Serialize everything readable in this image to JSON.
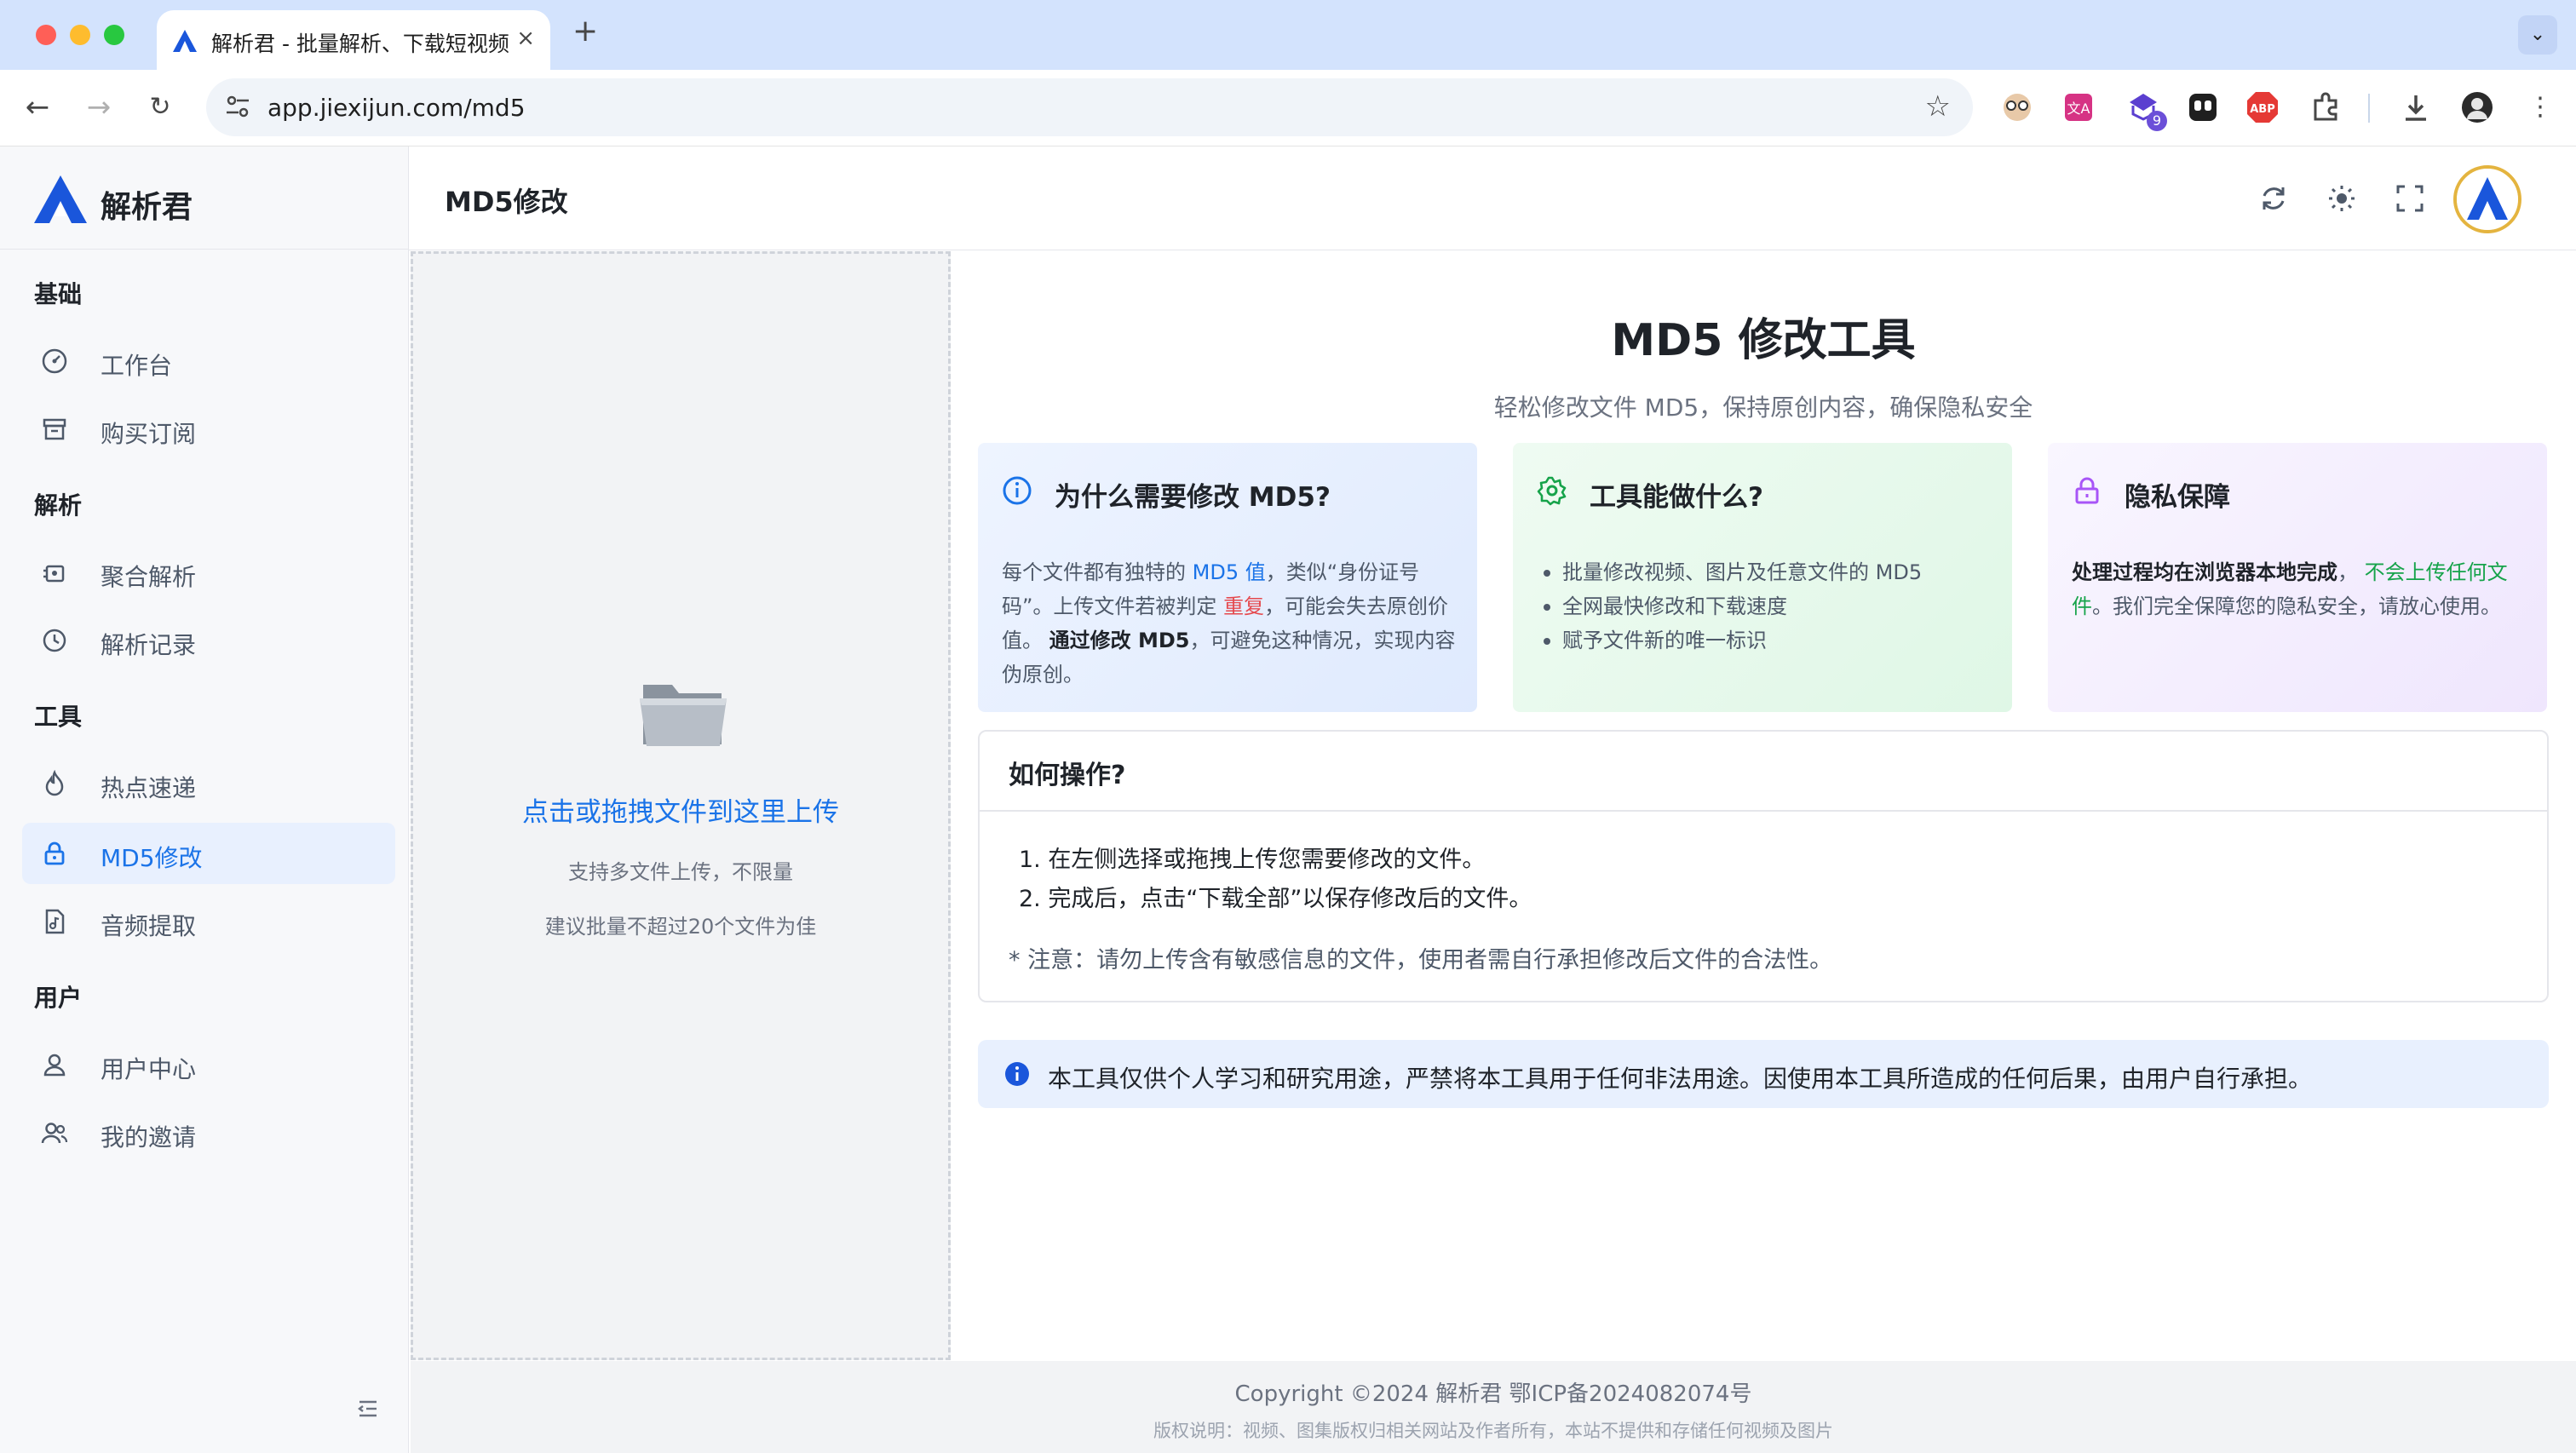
{
  "browser": {
    "tab_title": "解析君 - 批量解析、下载短视频",
    "tab_close": "×",
    "new_tab": "+",
    "url": "app.jiexijun.com/md5",
    "extension_badge": "9",
    "icons": [
      "back-icon",
      "forward-icon",
      "reload-icon",
      "site-info-icon",
      "bookmark-star-icon",
      "downloads-icon",
      "profile-icon",
      "more-icon"
    ]
  },
  "sidebar": {
    "brand_name": "解析君",
    "groups": [
      {
        "title": "基础",
        "items": [
          {
            "label": "工作台",
            "icon": "dashboard-icon"
          },
          {
            "label": "购买订阅",
            "icon": "archive-icon"
          }
        ]
      },
      {
        "title": "解析",
        "items": [
          {
            "label": "聚合解析",
            "icon": "aggregate-icon"
          },
          {
            "label": "解析记录",
            "icon": "history-icon"
          }
        ]
      },
      {
        "title": "工具",
        "items": [
          {
            "label": "热点速递",
            "icon": "fire-icon"
          },
          {
            "label": "MD5修改",
            "icon": "lock-icon",
            "active": true
          },
          {
            "label": "音频提取",
            "icon": "audio-file-icon"
          }
        ]
      },
      {
        "title": "用户",
        "items": [
          {
            "label": "用户中心",
            "icon": "user-icon"
          },
          {
            "label": "我的邀请",
            "icon": "users-icon"
          }
        ]
      }
    ]
  },
  "header": {
    "page_title": "MD5修改",
    "icons": [
      "refresh-icon",
      "theme-sun-icon",
      "fullscreen-icon",
      "avatar"
    ]
  },
  "upload": {
    "main": "点击或拖拽文件到这里上传",
    "sub1": "支持多文件上传，不限量",
    "sub2": "建议批量不超过20个文件为佳"
  },
  "main": {
    "title": "MD5 修改工具",
    "subtitle": "轻松修改文件 MD5，保持原创内容，确保隐私安全",
    "cards": {
      "why": {
        "title": "为什么需要修改 MD5?",
        "p1": "每个文件都有独特的 ",
        "p2": "MD5 值",
        "p3": "，类似“身份证号码”。上传文件若被判定 ",
        "p4": "重复",
        "p5": "，可能会失去原创价值。 ",
        "p6": "通过修改 MD5",
        "p7": "，可避免这种情况，实现内容伪原创。"
      },
      "what": {
        "title": "工具能做什么?",
        "items": [
          "批量修改视频、图片及任意文件的 MD5",
          "全网最快修改和下载速度",
          "赋予文件新的唯一标识"
        ]
      },
      "privacy": {
        "title": "隐私保障",
        "p1": "处理过程均在浏览器本地完成",
        "p2": "， ",
        "p3": "不会上传任何文件",
        "p4": "。我们完全保障您的隐私安全，请放心使用。"
      }
    },
    "howto": {
      "title": "如何操作?",
      "steps": [
        "1. 在左侧选择或拖拽上传您需要修改的文件。",
        "2. 完成后，点击“下载全部”以保存修改后的文件。"
      ],
      "note": "* 注意：请勿上传含有敏感信息的文件，使用者需自行承担修改后文件的合法性。"
    },
    "disclaimer": "本工具仅供个人学习和研究用途，严禁将本工具用于任何非法用途。因使用本工具所造成的任何后果，由用户自行承担。"
  },
  "footer": {
    "copyright": "Copyright ©2024 解析君 鄂ICP备2024082074号",
    "note": "版权说明：视频、图集版权归相关网站及作者所有，本站不提供和存储任何视频及图片"
  },
  "colors": {
    "accent": "#1a73e8",
    "danger": "#e5484d",
    "success": "#16a34a",
    "privacy": "#a855f7"
  }
}
